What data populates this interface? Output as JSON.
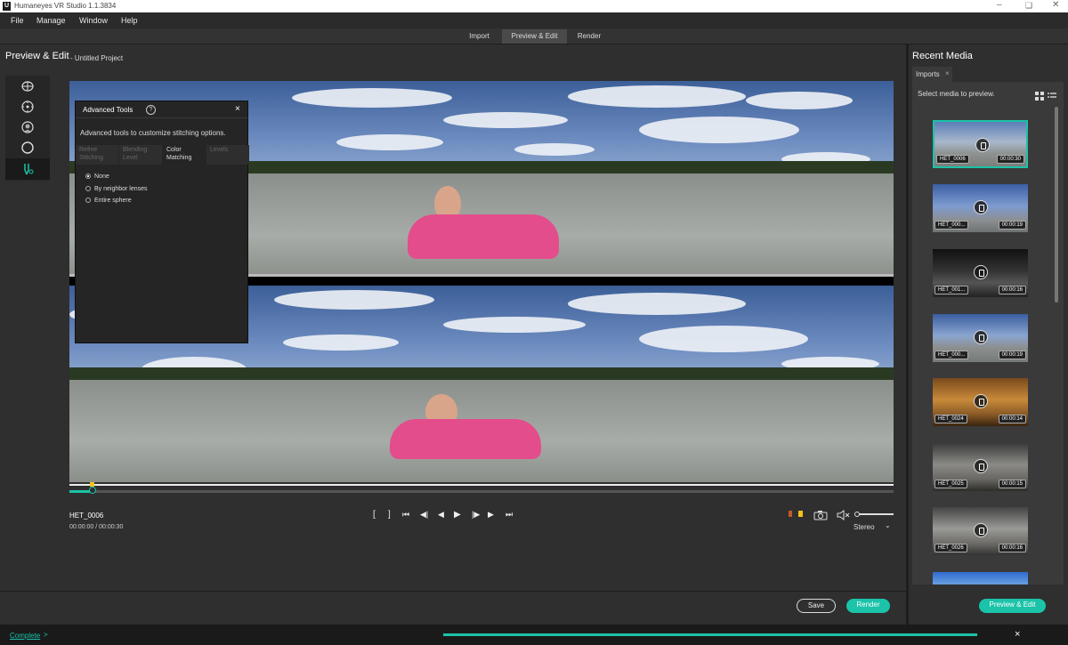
{
  "window": {
    "title": "Humaneyes VR Studio 1.1.3834",
    "logo": "U"
  },
  "menu": [
    "File",
    "Manage",
    "Window",
    "Help"
  ],
  "mode_tabs": [
    {
      "label": "Import",
      "active": false
    },
    {
      "label": "Preview & Edit",
      "active": true
    },
    {
      "label": "Render",
      "active": false
    }
  ],
  "main": {
    "heading": "Preview & Edit",
    "project": "- Untitled Project"
  },
  "tools": [
    "stitch-lens-icon",
    "target-icon",
    "face-icon",
    "sphere-icon",
    "advanced-tools-icon"
  ],
  "advanced_tools": {
    "title": "Advanced Tools",
    "help": "?",
    "close": "×",
    "description": "Advanced tools to customize stitching options.",
    "tabs": [
      {
        "label": "Refine Stitching",
        "active": false
      },
      {
        "label": "Blending Level",
        "active": false
      },
      {
        "label": "Color Matching",
        "active": true
      },
      {
        "label": "Levels",
        "active": false
      }
    ],
    "options": [
      {
        "label": "None",
        "selected": true
      },
      {
        "label": "By neighbor lenses",
        "selected": false
      },
      {
        "label": "Entire sphere",
        "selected": false
      }
    ]
  },
  "player": {
    "clip_name": "HET_0006",
    "timecode": "00:00:00 / 00:00:30",
    "view_mode": "Stereo",
    "progress": 0.0,
    "volume": 0.0
  },
  "actions": {
    "save": "Save",
    "render": "Render"
  },
  "recent_media": {
    "heading": "Recent Media",
    "tab": "Imports",
    "tab_close": "×",
    "hint": "Select media to preview.",
    "items": [
      {
        "name": "HET_0006",
        "duration": "00:00:30",
        "selected": true
      },
      {
        "name": "HET_000...",
        "duration": "00:00:19",
        "selected": false
      },
      {
        "name": "HET_001...",
        "duration": "00:00:16",
        "selected": false
      },
      {
        "name": "HET_000...",
        "duration": "00:00:19",
        "selected": false
      },
      {
        "name": "HET_0024",
        "duration": "00:00:14",
        "selected": false
      },
      {
        "name": "HET_0025",
        "duration": "00:00:15",
        "selected": false
      },
      {
        "name": "HET_0026",
        "duration": "00:00:16",
        "selected": false
      }
    ],
    "button": "Preview & Edit"
  },
  "status": {
    "label": "Complete",
    "chevron": ">",
    "progress": 1.0,
    "close": "×"
  },
  "colors": {
    "accent": "#1bc3a8",
    "panel": "#2f2f2f"
  }
}
